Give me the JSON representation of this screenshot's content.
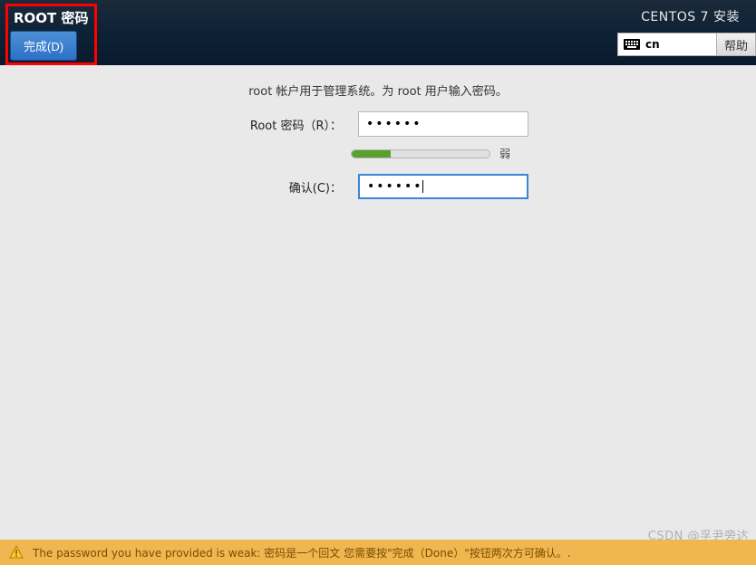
{
  "header": {
    "screen_title": "ROOT 密码",
    "done_label": "完成(D)",
    "installer_title": "CENTOS 7 安装",
    "keyboard_layout": "cn",
    "help_label": "帮助"
  },
  "main": {
    "description": "root 帐户用于管理系统。为 root 用户输入密码。",
    "password_label": "Root 密码（R）：",
    "password_value": "••••••",
    "confirm_label": "确认(C)：",
    "confirm_value": "••••••",
    "strength_label": "弱"
  },
  "status": {
    "warning_text": "The password you have provided is weak: 密码是一个回文 您需要按\"完成（Done）\"按钮两次方可确认。."
  },
  "watermark": "CSDN @孚尹旁达"
}
